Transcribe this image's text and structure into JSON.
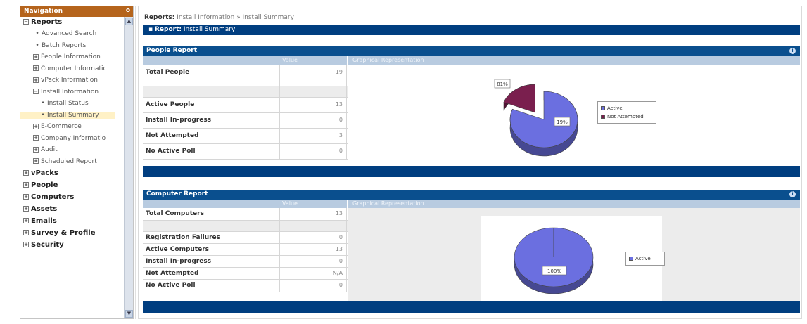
{
  "navigation": {
    "title": "Navigation",
    "close_glyph": "o",
    "items": [
      {
        "label": "Reports",
        "level": "top",
        "expander": "−"
      },
      {
        "label": "Advanced Search",
        "level": "leaf"
      },
      {
        "label": "Batch Reports",
        "level": "leaf"
      },
      {
        "label": "People Information",
        "level": "sub",
        "expander": "+"
      },
      {
        "label": "Computer Informatic",
        "level": "sub",
        "expander": "+"
      },
      {
        "label": "vPack Information",
        "level": "sub",
        "expander": "+"
      },
      {
        "label": "Install Information",
        "level": "sub",
        "expander": "−"
      },
      {
        "label": "Install Status",
        "level": "leaf2"
      },
      {
        "label": "Install Summary",
        "level": "leaf2",
        "selected": true
      },
      {
        "label": "E-Commerce",
        "level": "sub",
        "expander": "+"
      },
      {
        "label": "Company Informatio",
        "level": "sub",
        "expander": "+"
      },
      {
        "label": "Audit",
        "level": "sub",
        "expander": "+"
      },
      {
        "label": "Scheduled Report",
        "level": "sub",
        "expander": "+"
      },
      {
        "label": "vPacks",
        "level": "top",
        "expander": "+"
      },
      {
        "label": "People",
        "level": "top",
        "expander": "+"
      },
      {
        "label": "Computers",
        "level": "top",
        "expander": "+"
      },
      {
        "label": "Assets",
        "level": "top",
        "expander": "+"
      },
      {
        "label": "Emails",
        "level": "top",
        "expander": "+"
      },
      {
        "label": "Survey & Profile",
        "level": "top",
        "expander": "+"
      },
      {
        "label": "Security",
        "level": "top",
        "expander": "+"
      }
    ]
  },
  "breadcrumb": {
    "prefix": "Reports:",
    "path": "Install Information » Install Summary"
  },
  "report_bar": {
    "prefix": "Report:",
    "title": "Install Summary"
  },
  "people_report": {
    "title": "People Report",
    "col_value": "Value",
    "col_graph": "Graphical Representation",
    "rows": [
      {
        "label": "Total People",
        "value": "19"
      },
      {
        "label": "",
        "value": ""
      },
      {
        "label": "Active People",
        "value": "13"
      },
      {
        "label": "Install In-progress",
        "value": "0"
      },
      {
        "label": "Not Attempted",
        "value": "3"
      },
      {
        "label": "No Active Poll",
        "value": "0"
      }
    ],
    "chart_data": {
      "type": "pie",
      "slices": [
        {
          "name": "Active",
          "value": 81,
          "label": "81%",
          "color": "#6b6fe0"
        },
        {
          "name": "Not Attempted",
          "value": 19,
          "label": "19%",
          "color": "#7a1f4e"
        }
      ],
      "legend_placement": "right"
    }
  },
  "computer_report": {
    "title": "Computer Report",
    "col_value": "Value",
    "col_graph": "Graphical Representation",
    "rows": [
      {
        "label": "Total Computers",
        "value": "13"
      },
      {
        "label": "",
        "value": ""
      },
      {
        "label": "Registration Failures",
        "value": "0"
      },
      {
        "label": "Active Computers",
        "value": "13"
      },
      {
        "label": "Install In-progress",
        "value": "0"
      },
      {
        "label": "Not Attempted",
        "value": "N/A"
      },
      {
        "label": "No Active Poll",
        "value": "0"
      }
    ],
    "chart_data": {
      "type": "pie",
      "slices": [
        {
          "name": "Active",
          "value": 100,
          "label": "100%",
          "color": "#6b6fe0"
        }
      ],
      "legend_placement": "right"
    }
  },
  "colors": {
    "nav_header": "#b5641c",
    "bar_blue": "#003e80",
    "col_header": "#b8cbe0"
  },
  "icons": {
    "panel_toggle": "i"
  }
}
